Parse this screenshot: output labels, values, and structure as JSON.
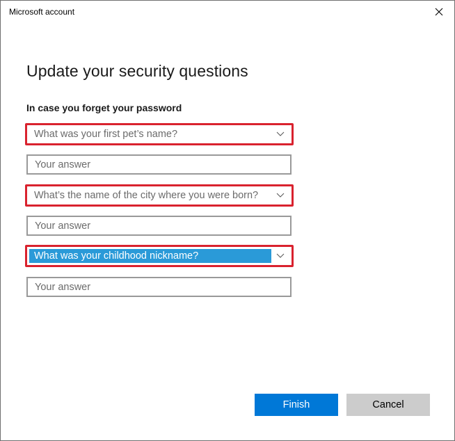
{
  "window": {
    "title": "Microsoft account",
    "close_icon": "close-icon"
  },
  "page": {
    "heading": "Update your security questions",
    "subheading": "In case you forget your password"
  },
  "questions": [
    {
      "selected": "What was your first pet’s name?",
      "answer_placeholder": "Your answer",
      "highlighted": false
    },
    {
      "selected": "What’s the name of the city where you were born?",
      "answer_placeholder": "Your answer",
      "highlighted": false
    },
    {
      "selected": "What was your childhood nickname?",
      "answer_placeholder": "Your answer",
      "highlighted": true
    }
  ],
  "buttons": {
    "finish": "Finish",
    "cancel": "Cancel"
  },
  "colors": {
    "accent": "#0078d7",
    "selection": "#2a9ad8",
    "annotation": "#d9222e",
    "cancel_bg": "#cccccc"
  }
}
